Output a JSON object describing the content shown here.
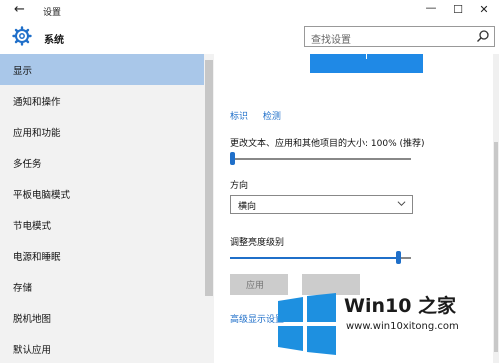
{
  "window": {
    "title": "设置",
    "back_glyph": "←",
    "minimize_glyph": "—",
    "maximize_glyph": "☐",
    "close_glyph": "✕"
  },
  "header": {
    "app_name": "系统",
    "app_icon": "gear-icon",
    "search_placeholder": "查找设置",
    "search_icon": "search-icon"
  },
  "sidebar": {
    "items": [
      {
        "label": "显示",
        "active": true
      },
      {
        "label": "通知和操作",
        "active": false
      },
      {
        "label": "应用和功能",
        "active": false
      },
      {
        "label": "多任务",
        "active": false
      },
      {
        "label": "平板电脑模式",
        "active": false
      },
      {
        "label": "节电模式",
        "active": false
      },
      {
        "label": "电源和睡眠",
        "active": false
      },
      {
        "label": "存储",
        "active": false
      },
      {
        "label": "脱机地图",
        "active": false
      },
      {
        "label": "默认应用",
        "active": false
      }
    ]
  },
  "content": {
    "links": [
      "标识",
      "检测"
    ],
    "scale_label": "更改文本、应用和其他项目的大小: 100% (推荐)",
    "scale_slider_fraction": 0.0,
    "orientation_label": "方向",
    "orientation_value": "横向",
    "brightness_label": "调整亮度级别",
    "brightness_slider_fraction": 0.93,
    "apply_label": "应用",
    "advanced_link": "高级显示设置"
  },
  "watermark": {
    "title": "Win10 之家",
    "url": "www.win10xitong.com",
    "colors": {
      "logo_blue": "#1e90e0",
      "text": "#1b1b1b"
    }
  },
  "colors": {
    "accent": "#1f6fc9",
    "sidebar_bg": "#f2f2f2",
    "active_item": "#a9c7e9",
    "monitor": "#1f89e6"
  }
}
